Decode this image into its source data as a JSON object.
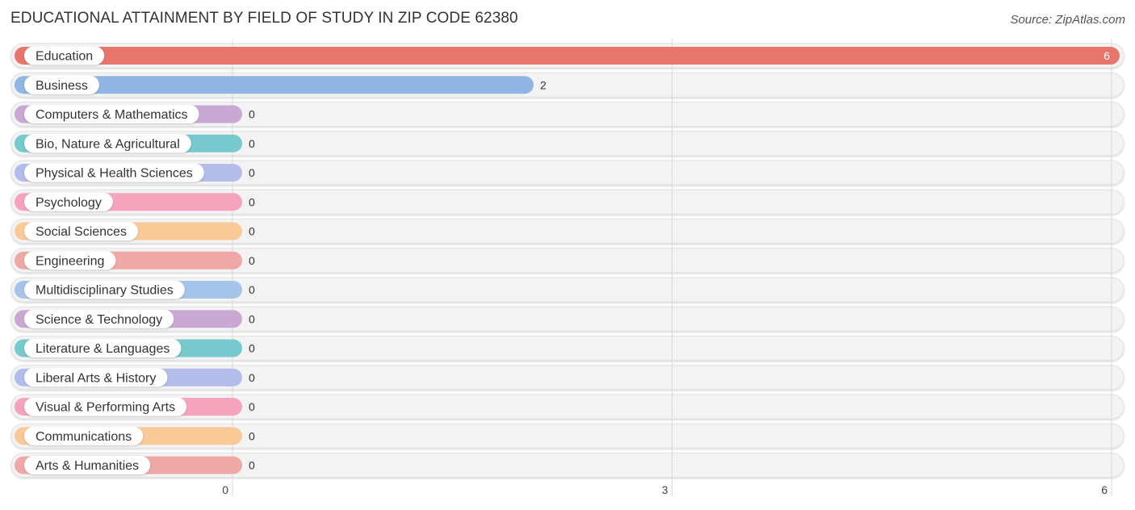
{
  "header": {
    "title": "EDUCATIONAL ATTAINMENT BY FIELD OF STUDY IN ZIP CODE 62380",
    "source": "Source: ZipAtlas.com"
  },
  "chart_data": {
    "type": "bar",
    "orientation": "horizontal",
    "title": "EDUCATIONAL ATTAINMENT BY FIELD OF STUDY IN ZIP CODE 62380",
    "source": "Source: ZipAtlas.com",
    "xlabel": "",
    "ylabel": "",
    "xlim": [
      0,
      6
    ],
    "xticks": [
      0,
      3,
      6
    ],
    "grid": true,
    "legend": "none",
    "categories": [
      "Education",
      "Business",
      "Computers & Mathematics",
      "Bio, Nature & Agricultural",
      "Physical & Health Sciences",
      "Psychology",
      "Social Sciences",
      "Engineering",
      "Multidisciplinary Studies",
      "Science & Technology",
      "Literature & Languages",
      "Liberal Arts & History",
      "Visual & Performing Arts",
      "Communications",
      "Arts & Humanities"
    ],
    "values": [
      6,
      2,
      0,
      0,
      0,
      0,
      0,
      0,
      0,
      0,
      0,
      0,
      0,
      0,
      0
    ],
    "colors": [
      "#e8766d",
      "#8fb6e4",
      "#c9a9d3",
      "#76c9cc",
      "#b2bde9",
      "#f6a3bd",
      "#f9c998",
      "#eea9a6",
      "#a5c4ea",
      "#c9a9d3",
      "#76c9cc",
      "#b2bde9",
      "#f6a3bd",
      "#f9c998",
      "#eea9a6"
    ]
  }
}
